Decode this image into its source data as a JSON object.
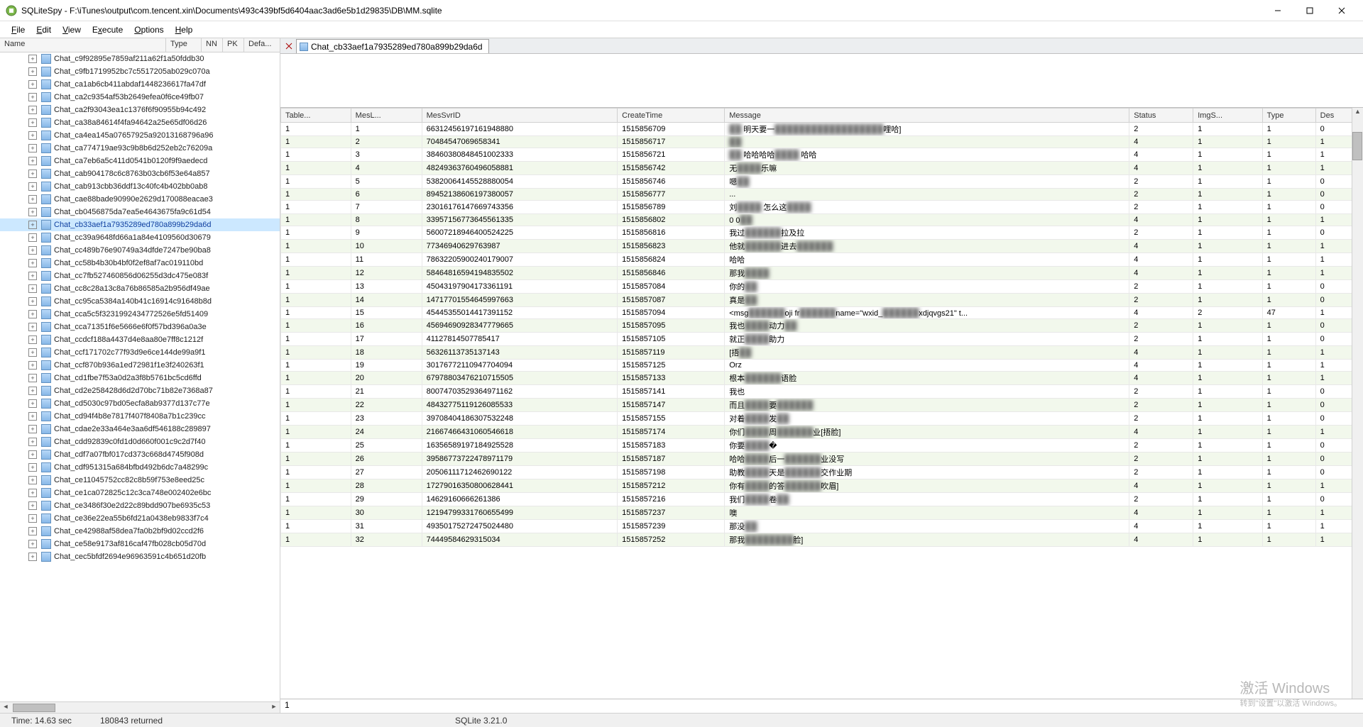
{
  "window": {
    "title": "SQLiteSpy - F:\\iTunes\\output\\com.tencent.xin\\Documents\\493c439bf5d6404aac3ad6e5b1d29835\\DB\\MM.sqlite"
  },
  "menu": {
    "file": "File",
    "edit": "Edit",
    "view": "View",
    "execute": "Execute",
    "options": "Options",
    "help": "Help"
  },
  "tree_header": {
    "name": "Name",
    "type": "Type",
    "nn": "NN",
    "pk": "PK",
    "default": "Defa..."
  },
  "tree": {
    "selected_index": 13,
    "items": [
      "Chat_c9f92895e7859af211a62f1a50fddb30",
      "Chat_c9fb1719952bc7c5517205ab029c070a",
      "Chat_ca1ab6cb411abdaf1448236617fa47df",
      "Chat_ca2c9354af53b2649efea0f6ce49fb07",
      "Chat_ca2f93043ea1c1376f6f90955b94c492",
      "Chat_ca38a84614f4fa94642a25e65df06d26",
      "Chat_ca4ea145a07657925a92013168796a96",
      "Chat_ca774719ae93c9b8b6d252eb2c76209a",
      "Chat_ca7eb6a5c411d0541b0120f9f9aedecd",
      "Chat_cab904178c6c8763b03cb6f53e64a857",
      "Chat_cab913cbb36ddf13c40fc4b402bb0ab8",
      "Chat_cae88bade90990e2629d170088eacae3",
      "Chat_cb0456875da7ea5e4643675fa9c61d54",
      "Chat_cb33aef1a7935289ed780a899b29da6d",
      "Chat_cc39a9648fd66a1a84e4109560d30679",
      "Chat_cc489b76e90749a34dfde7247be90ba8",
      "Chat_cc58b4b30b4bf0f2ef8af7ac019110bd",
      "Chat_cc7fb527460856d06255d3dc475e083f",
      "Chat_cc8c28a13c8a76b86585a2b956df49ae",
      "Chat_cc95ca5384a140b41c16914c91648b8d",
      "Chat_cca5c5f3231992434772526e5fd51409",
      "Chat_cca71351f6e5666e6f0f57bd396a0a3e",
      "Chat_ccdcf188a4437d4e8aa80e7ff8c1212f",
      "Chat_ccf171702c77f93d9e6ce144de99a9f1",
      "Chat_ccf870b936a1ed72981f1e3f240263f1",
      "Chat_cd1fbe7f53a0d2a3f8b5761bc5cd6ffd",
      "Chat_cd2e258428d6d2d70bc71b82e7368a87",
      "Chat_cd5030c97bd05ecfa8ab9377d137c77e",
      "Chat_cd94f4b8e7817f407f8408a7b1c239cc",
      "Chat_cdae2e33a464e3aa6df546188c289897",
      "Chat_cdd92839c0fd1d0d660f001c9c2d7f40",
      "Chat_cdf7a07fbf017cd373c668d4745f908d",
      "Chat_cdf951315a684bfbd492b6dc7a48299c",
      "Chat_ce11045752cc82c8b59f753e8eed25c",
      "Chat_ce1ca072825c12c3ca748e002402e6bc",
      "Chat_ce3486f30e2d22c89bdd907be6935c53",
      "Chat_ce36e22ea55b6fd21a0438eb9833f7c4",
      "Chat_ce42988af58dea7fa0b2bf9d02ccd2f6",
      "Chat_ce58e9173af816caf47fb028cb05d70d",
      "Chat_cec5bfdf2694e96963591c4b651d20fb"
    ]
  },
  "tab": {
    "label": "Chat_cb33aef1a7935289ed780a899b29da6d"
  },
  "grid": {
    "columns": [
      "Table...",
      "MesL...",
      "MesSvrID",
      "CreateTime",
      "Message",
      "Status",
      "ImgS...",
      "Type",
      "Des"
    ],
    "rows": [
      {
        "t": 1,
        "ml": 1,
        "svr": "66312456197161948880",
        "ct": "1515856709",
        "msg": "▓   明天要一▓▓▓▓▓▓▓▓▓哩哈]",
        "st": 2,
        "img": 1,
        "tp": 1,
        "des": 0
      },
      {
        "t": 1,
        "ml": 2,
        "svr": "70484547069658341",
        "ct": "1515856717",
        "msg": "▓",
        "st": 4,
        "img": 1,
        "tp": 1,
        "des": 1
      },
      {
        "t": 1,
        "ml": 3,
        "svr": "38460380848451002333",
        "ct": "1515856721",
        "msg": "▓   哈哈哈哈▓▓   哈哈",
        "st": 4,
        "img": 1,
        "tp": 1,
        "des": 1
      },
      {
        "t": 1,
        "ml": 4,
        "svr": "48249363760496058881",
        "ct": "1515856742",
        "msg": "无▓▓乐嘛",
        "st": 4,
        "img": 1,
        "tp": 1,
        "des": 1
      },
      {
        "t": 1,
        "ml": 5,
        "svr": "53820064145528880054",
        "ct": "1515856746",
        "msg": "嗯▓",
        "st": 2,
        "img": 1,
        "tp": 1,
        "des": 0
      },
      {
        "t": 1,
        "ml": 6,
        "svr": "89452138606197380057",
        "ct": "1515856777",
        "msg": "...",
        "st": 2,
        "img": 1,
        "tp": 1,
        "des": 0
      },
      {
        "t": 1,
        "ml": 7,
        "svr": "23016176147669743356",
        "ct": "1515856789",
        "msg": "刘▓▓   怎么这▓▓",
        "st": 2,
        "img": 1,
        "tp": 1,
        "des": 0
      },
      {
        "t": 1,
        "ml": 8,
        "svr": "33957156773645561335",
        "ct": "1515856802",
        "msg": "0 0▓",
        "st": 4,
        "img": 1,
        "tp": 1,
        "des": 1
      },
      {
        "t": 1,
        "ml": 9,
        "svr": "56007218946400524225",
        "ct": "1515856816",
        "msg": "我过▓▓▓拉及拉",
        "st": 2,
        "img": 1,
        "tp": 1,
        "des": 0
      },
      {
        "t": 1,
        "ml": 10,
        "svr": "77346940629763987",
        "ct": "1515856823",
        "msg": "他就▓▓▓进去▓▓▓",
        "st": 4,
        "img": 1,
        "tp": 1,
        "des": 1
      },
      {
        "t": 1,
        "ml": 11,
        "svr": "78632205900240179007",
        "ct": "1515856824",
        "msg": "哈哈",
        "st": 4,
        "img": 1,
        "tp": 1,
        "des": 1
      },
      {
        "t": 1,
        "ml": 12,
        "svr": "58464816594194835502",
        "ct": "1515856846",
        "msg": "那我▓▓",
        "st": 4,
        "img": 1,
        "tp": 1,
        "des": 1
      },
      {
        "t": 1,
        "ml": 13,
        "svr": "45043197904173361191",
        "ct": "1515857084",
        "msg": "你的▓",
        "st": 2,
        "img": 1,
        "tp": 1,
        "des": 0
      },
      {
        "t": 1,
        "ml": 14,
        "svr": "14717701554645997663",
        "ct": "1515857087",
        "msg": "真是▓",
        "st": 2,
        "img": 1,
        "tp": 1,
        "des": 0
      },
      {
        "t": 1,
        "ml": 15,
        "svr": "45445355014417391152",
        "ct": "1515857094",
        "msg": "<msg▓▓▓oji fr▓▓▓name=\"wxid_▓▓▓xdjqvgs21\" t...",
        "st": 4,
        "img": 2,
        "tp": 47,
        "des": 1
      },
      {
        "t": 1,
        "ml": 16,
        "svr": "45694690928347779665",
        "ct": "1515857095",
        "msg": "我也▓▓动力▓",
        "st": 2,
        "img": 1,
        "tp": 1,
        "des": 0
      },
      {
        "t": 1,
        "ml": 17,
        "svr": "41127814507785417",
        "ct": "1515857105",
        "msg": "就正▓▓助力",
        "st": 2,
        "img": 1,
        "tp": 1,
        "des": 0
      },
      {
        "t": 1,
        "ml": 18,
        "svr": "56326113735137143",
        "ct": "1515857119",
        "msg": "[捂▓",
        "st": 4,
        "img": 1,
        "tp": 1,
        "des": 1
      },
      {
        "t": 1,
        "ml": 19,
        "svr": "30176772110947704094",
        "ct": "1515857125",
        "msg": "Orz",
        "st": 4,
        "img": 1,
        "tp": 1,
        "des": 1
      },
      {
        "t": 1,
        "ml": 20,
        "svr": "67978803476210715505",
        "ct": "1515857133",
        "msg": "根本▓▓▓语脸",
        "st": 4,
        "img": 1,
        "tp": 1,
        "des": 1
      },
      {
        "t": 1,
        "ml": 21,
        "svr": "80074703529364971162",
        "ct": "1515857141",
        "msg": "我也",
        "st": 2,
        "img": 1,
        "tp": 1,
        "des": 0
      },
      {
        "t": 1,
        "ml": 22,
        "svr": "48432775119126085533",
        "ct": "1515857147",
        "msg": "而且▓▓要▓▓▓",
        "st": 2,
        "img": 1,
        "tp": 1,
        "des": 0
      },
      {
        "t": 1,
        "ml": 23,
        "svr": "39708404186307532248",
        "ct": "1515857155",
        "msg": "对着▓▓发▓",
        "st": 2,
        "img": 1,
        "tp": 1,
        "des": 0
      },
      {
        "t": 1,
        "ml": 24,
        "svr": "21667466431060546618",
        "ct": "1515857174",
        "msg": "你们▓▓周▓▓▓业[捂脸]",
        "st": 4,
        "img": 1,
        "tp": 1,
        "des": 1
      },
      {
        "t": 1,
        "ml": 25,
        "svr": "16356589197184925528",
        "ct": "1515857183",
        "msg": "你要▓▓�",
        "st": 2,
        "img": 1,
        "tp": 1,
        "des": 0
      },
      {
        "t": 1,
        "ml": 26,
        "svr": "39586773722478971179",
        "ct": "1515857187",
        "msg": "哈哈▓▓后一▓▓▓业没写",
        "st": 2,
        "img": 1,
        "tp": 1,
        "des": 0
      },
      {
        "t": 1,
        "ml": 27,
        "svr": "20506111712462690122",
        "ct": "1515857198",
        "msg": "助教▓▓天是▓▓▓交作业期",
        "st": 2,
        "img": 1,
        "tp": 1,
        "des": 0
      },
      {
        "t": 1,
        "ml": 28,
        "svr": "17279016350800628441",
        "ct": "1515857212",
        "msg": "你有▓▓的答▓▓▓吹眉]",
        "st": 4,
        "img": 1,
        "tp": 1,
        "des": 1
      },
      {
        "t": 1,
        "ml": 29,
        "svr": "14629160666261386",
        "ct": "1515857216",
        "msg": "我们▓▓卷▓",
        "st": 2,
        "img": 1,
        "tp": 1,
        "des": 0
      },
      {
        "t": 1,
        "ml": 30,
        "svr": "12194799331760655499",
        "ct": "1515857237",
        "msg": "噢",
        "st": 4,
        "img": 1,
        "tp": 1,
        "des": 1
      },
      {
        "t": 1,
        "ml": 31,
        "svr": "49350175272475024480",
        "ct": "1515857239",
        "msg": "那没▓",
        "st": 4,
        "img": 1,
        "tp": 1,
        "des": 1
      },
      {
        "t": 1,
        "ml": 32,
        "svr": "74449584629315034",
        "ct": "1515857252",
        "msg": "那我▓▓▓▓脸]",
        "st": 4,
        "img": 1,
        "tp": 1,
        "des": 1
      }
    ]
  },
  "bottom_input": "1",
  "status": {
    "time": "Time: 14.63 sec",
    "returned": "180843 returned",
    "engine": "SQLite 3.21.0"
  },
  "watermark": {
    "big": "激活 Windows",
    "small": "转到\"设置\"以激活 Windows。"
  }
}
